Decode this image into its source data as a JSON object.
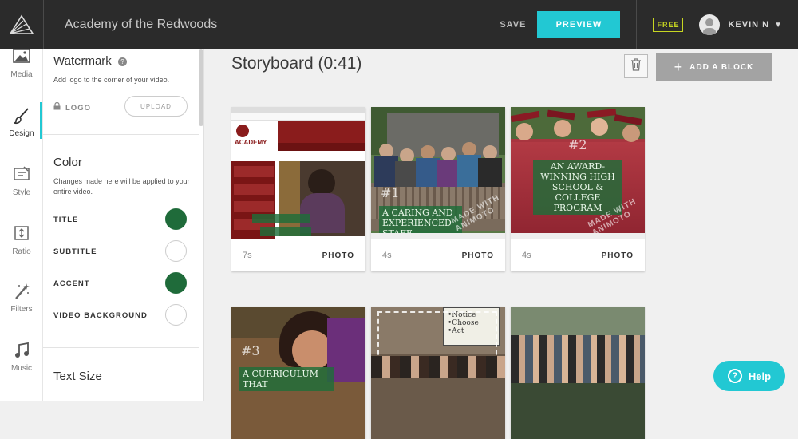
{
  "app": {
    "project_title": "Academy of the Redwoods"
  },
  "topbar": {
    "save_label": "SAVE",
    "preview_label": "PREVIEW",
    "plan_badge": "FREE",
    "user_name": "KEVIN N"
  },
  "rail": {
    "items": [
      {
        "label": "Media",
        "icon": "image-icon"
      },
      {
        "label": "Design",
        "icon": "brush-icon"
      },
      {
        "label": "Style",
        "icon": "style-icon"
      },
      {
        "label": "Ratio",
        "icon": "ratio-icon"
      },
      {
        "label": "Filters",
        "icon": "magic-wand-icon"
      },
      {
        "label": "Music",
        "icon": "music-note-icon"
      }
    ],
    "active": "Design"
  },
  "panel": {
    "watermark": {
      "title": "Watermark",
      "description": "Add logo to the corner of your video.",
      "logo_label": "LOGO",
      "upload_label": "UPLOAD"
    },
    "color": {
      "title": "Color",
      "description": "Changes made here will be applied to your entire video.",
      "items": [
        {
          "label": "TITLE",
          "color": "#1f6b3a"
        },
        {
          "label": "SUBTITLE",
          "color": "#ffffff"
        },
        {
          "label": "ACCENT",
          "color": "#1f6b3a"
        },
        {
          "label": "VIDEO BACKGROUND",
          "color": "#ffffff"
        }
      ]
    },
    "text_size": {
      "title": "Text Size"
    }
  },
  "storyboard": {
    "title": "Storyboard (0:41)",
    "add_block_label": "ADD A BLOCK",
    "cards": [
      {
        "duration": "7s",
        "type": "PHOTO",
        "caption": ""
      },
      {
        "duration": "4s",
        "type": "PHOTO",
        "caption": "A CARING AND EXPERIENCED STAFF",
        "number": "#1"
      },
      {
        "duration": "4s",
        "type": "PHOTO",
        "caption": "AN AWARD-WINNING HIGH SCHOOL & COLLEGE PROGRAM",
        "number": "#2"
      },
      {
        "duration": "",
        "type": "",
        "caption": "A CURRICULUM THAT",
        "number": "#3"
      },
      {
        "duration": "",
        "type": "",
        "caption": ""
      },
      {
        "duration": "",
        "type": "",
        "caption": ""
      }
    ],
    "watermark_text": "MADE WITH ANIMOTO"
  },
  "help": {
    "label": "Help"
  },
  "colors": {
    "accent": "#22c8d3",
    "badge": "#c7d622",
    "topbar": "#2b2b2b"
  }
}
